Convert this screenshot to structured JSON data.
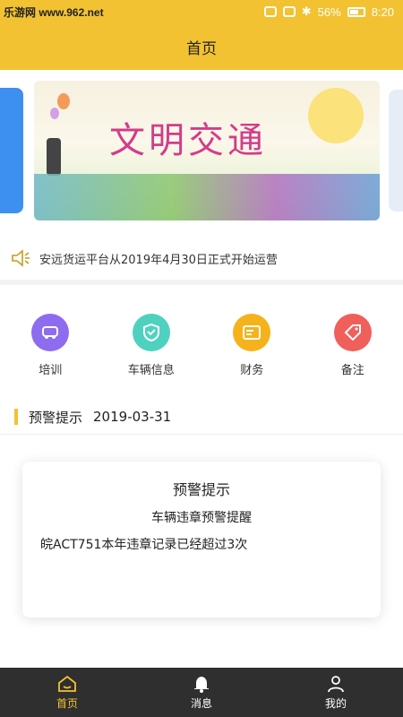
{
  "status_bar": {
    "watermark": "乐游网 www.962.net",
    "battery": "56%",
    "time": "8:20"
  },
  "header": {
    "title": "首页"
  },
  "banner": {
    "art_title": "文明交通"
  },
  "notice": {
    "text": "安远货运平台从2019年4月30日正式开始运营"
  },
  "menu": {
    "items": [
      {
        "label": "培训",
        "color": "#8e6cf0"
      },
      {
        "label": "车辆信息",
        "color": "#4fd1c0"
      },
      {
        "label": "财务",
        "color": "#f6b21a"
      },
      {
        "label": "备注",
        "color": "#f05f5a"
      }
    ]
  },
  "warning": {
    "heading": "预警提示",
    "date": "2019-03-31",
    "card": {
      "title": "预警提示",
      "subtitle": "车辆违章预警提醒",
      "body": "皖ACT751本年违章记录已经超过3次"
    }
  },
  "bottom_nav": {
    "items": [
      {
        "label": "首页",
        "active": true
      },
      {
        "label": "消息",
        "active": false
      },
      {
        "label": "我的",
        "active": false
      }
    ]
  }
}
